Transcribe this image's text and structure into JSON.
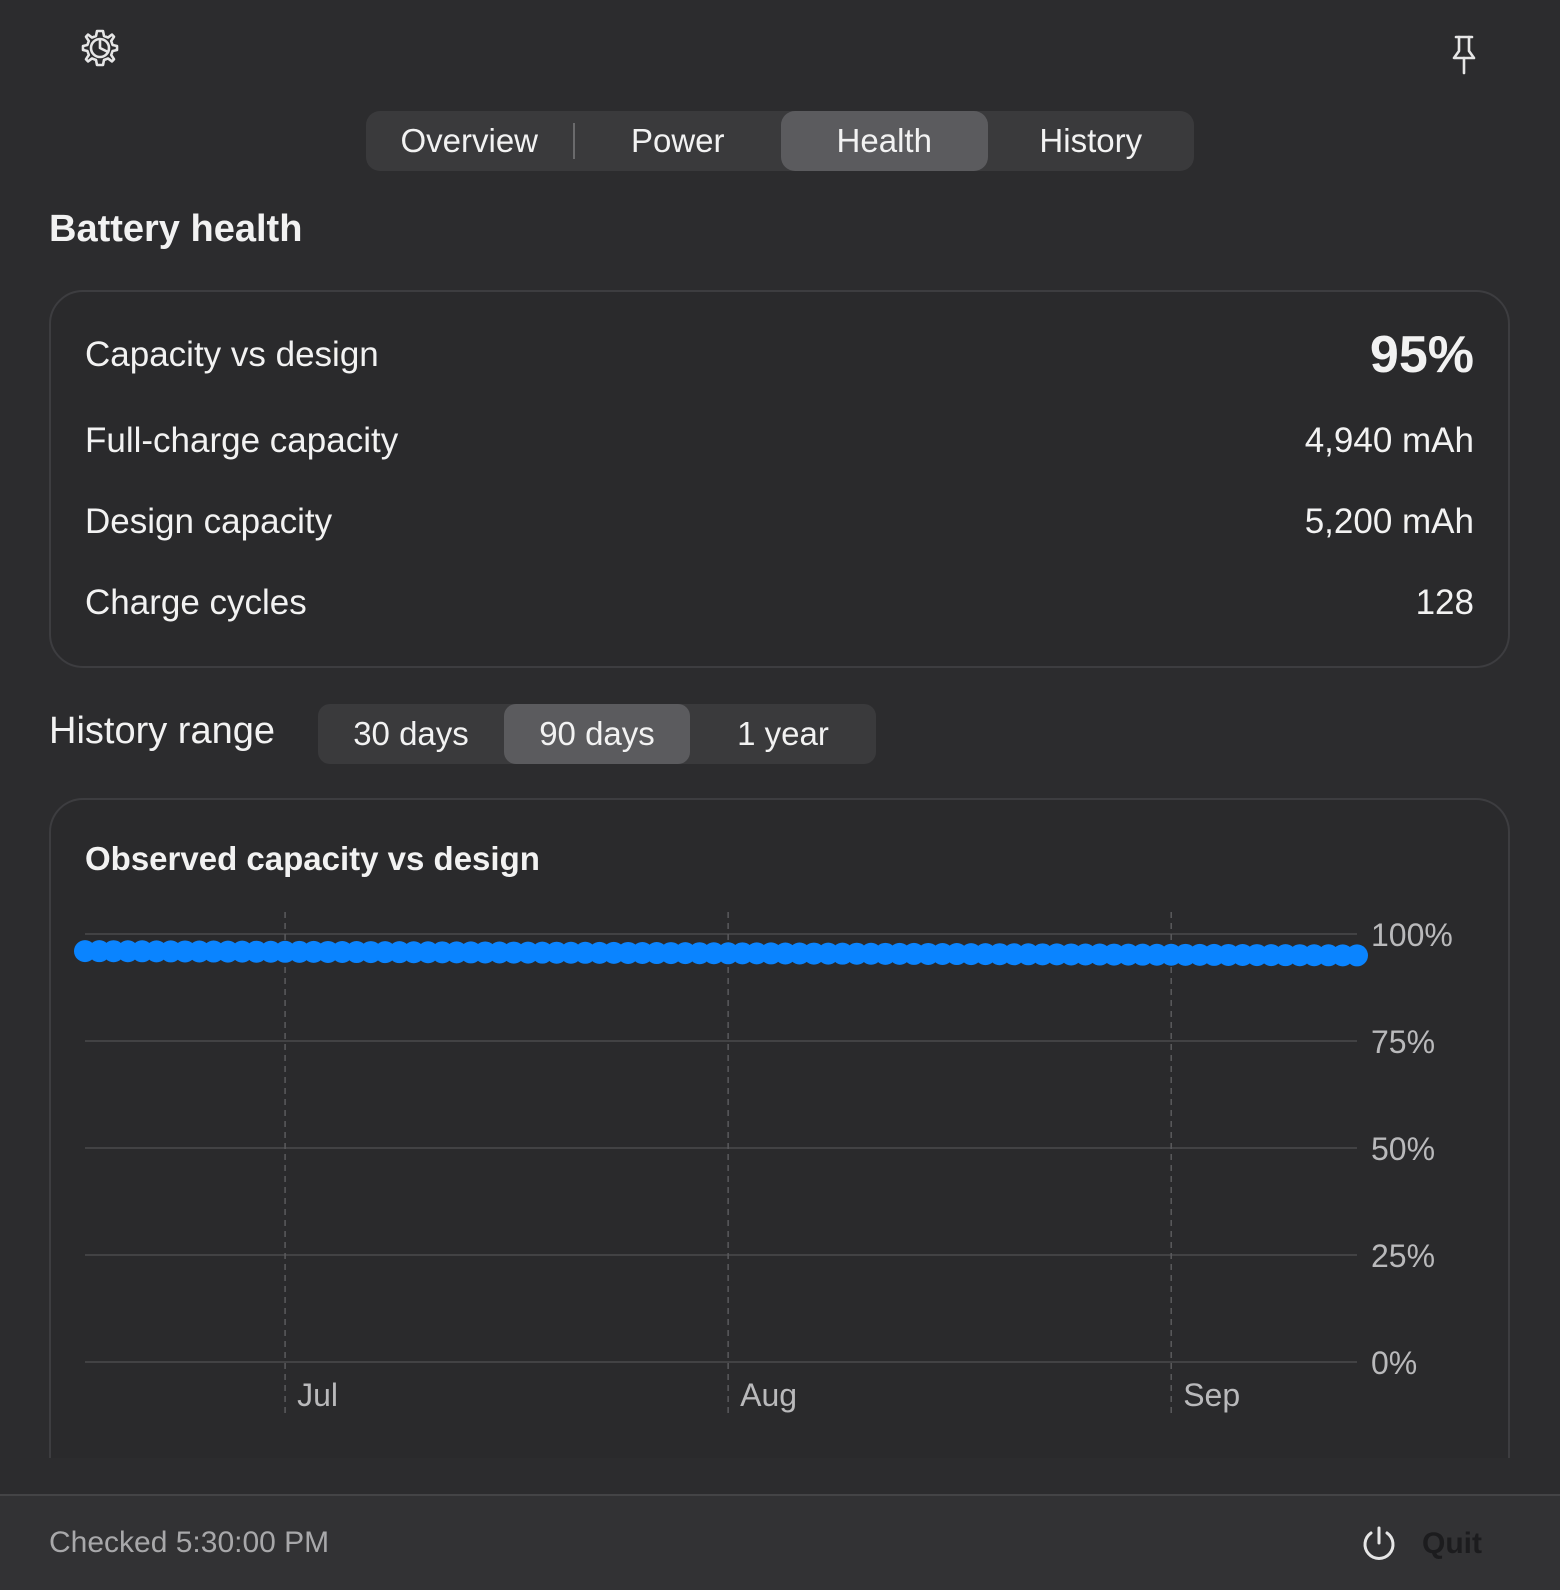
{
  "header": {
    "settings_icon": "gear-icon",
    "pin_icon": "pin-icon"
  },
  "tabs": [
    {
      "label": "Overview",
      "active": false
    },
    {
      "label": "Power",
      "active": false
    },
    {
      "label": "Health",
      "active": true
    },
    {
      "label": "History",
      "active": false
    }
  ],
  "section": {
    "title": "Battery health"
  },
  "stats": {
    "capacity_vs_design": {
      "label": "Capacity vs design",
      "value": "95%"
    },
    "full_charge_capacity": {
      "label": "Full-charge capacity",
      "value": "4,940 mAh"
    },
    "design_capacity": {
      "label": "Design capacity",
      "value": "5,200 mAh"
    },
    "charge_cycles": {
      "label": "Charge cycles",
      "value": "128"
    }
  },
  "history_range": {
    "label": "History range",
    "options": [
      {
        "label": "30 days",
        "active": false
      },
      {
        "label": "90 days",
        "active": true
      },
      {
        "label": "1 year",
        "active": false
      }
    ]
  },
  "chart_data": {
    "type": "scatter",
    "title": "Observed capacity vs design",
    "xlabel": "",
    "ylabel": "",
    "x_axis": "date",
    "xlim": [
      "2025-06-17",
      "2025-09-14"
    ],
    "xticks": [
      {
        "date": "2025-07-01",
        "label": "Jul"
      },
      {
        "date": "2025-08-01",
        "label": "Aug"
      },
      {
        "date": "2025-09-01",
        "label": "Sep"
      }
    ],
    "ylim": [
      0,
      100
    ],
    "yticks": [
      {
        "value": 100,
        "label": "100%"
      },
      {
        "value": 75,
        "label": "75%"
      },
      {
        "value": 50,
        "label": "50%"
      },
      {
        "value": 25,
        "label": "25%"
      },
      {
        "value": 0,
        "label": "0%"
      }
    ],
    "y_axis_side": "right",
    "grid": "horizontal solid, vertical dashed at month starts",
    "series": [
      {
        "color": "#0a84ff",
        "start_date": "2025-06-17",
        "end_date": "2025-09-14",
        "interval": "daily",
        "start_value": 96,
        "end_value": 95
      }
    ]
  },
  "footer": {
    "checked_text": "Checked 5:30:00 PM",
    "quit_label": "Quit",
    "quit_icon": "power-icon"
  },
  "colors": {
    "accent": "#0a84ff",
    "background": "#2c2c2e"
  }
}
